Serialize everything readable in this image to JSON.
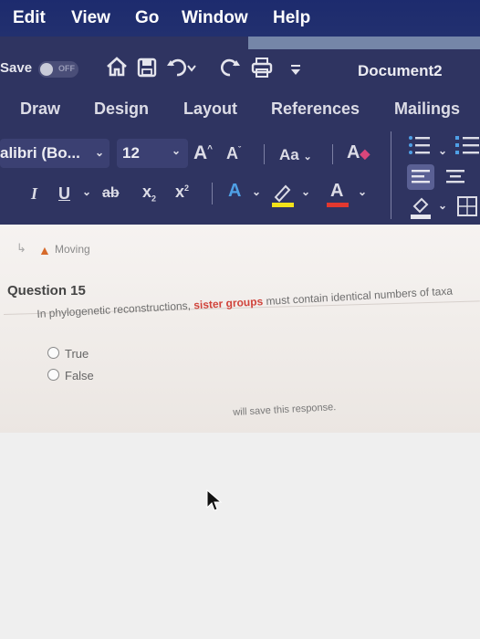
{
  "menubar": {
    "items": [
      "Edit",
      "View",
      "Go",
      "Window",
      "Help"
    ]
  },
  "quick_access": {
    "autosave_label": "Save",
    "autosave_state": "OFF",
    "document_title": "Document2",
    "icons": [
      "home-icon",
      "save-icon",
      "undo-icon",
      "redo-icon",
      "print-icon",
      "customize-icon"
    ]
  },
  "ribbon": {
    "tabs": [
      "Draw",
      "Design",
      "Layout",
      "References",
      "Mailings"
    ],
    "font_name": "alibri (Bo...",
    "font_size": "12",
    "case_label": "Aa",
    "grow_font": "A",
    "shrink_font": "A",
    "italic": "I",
    "underline": "U",
    "strikethrough": "ab",
    "subscript": "x",
    "superscript": "x",
    "text_effects": "A",
    "highlight_color": "#f2e21a",
    "font_color_letter": "A",
    "font_color": "#e2382f"
  },
  "document": {
    "notice": "Moving",
    "question_title": "Question 15",
    "question_text_before": "In phylogenetic reconstructions, ",
    "question_text_highlight": "sister groups",
    "question_text_after": " must contain identical numbers of taxa",
    "options": [
      "True",
      "False"
    ],
    "save_note": "will save this response."
  }
}
